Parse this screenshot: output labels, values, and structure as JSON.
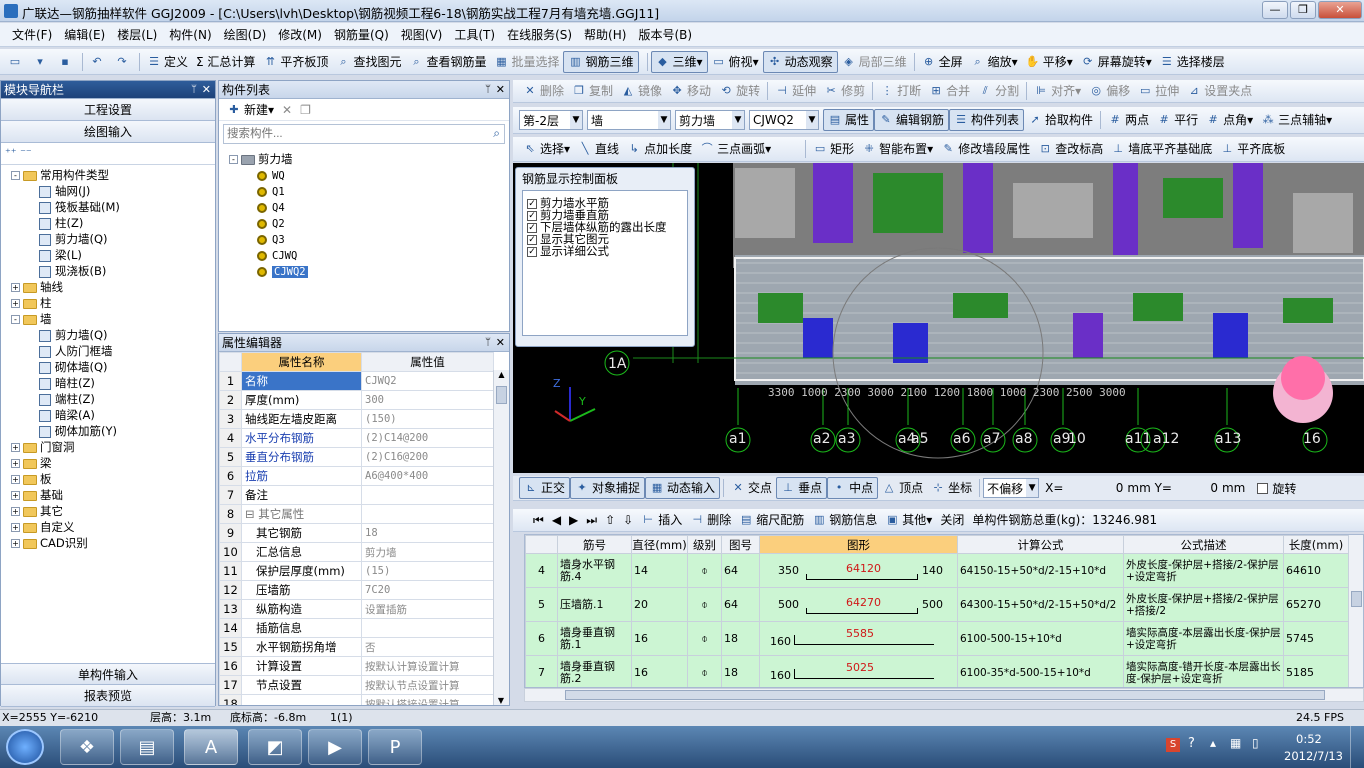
{
  "window": {
    "title": "广联达—钢筋抽样软件 GGJ2009 - [C:\\Users\\lvh\\Desktop\\钢筋视频工程6-18\\钢筋实战工程7月有墙充墙.GGJ11]",
    "minimize": "—",
    "restore": "❐",
    "close": "✕"
  },
  "menu": [
    "文件(F)",
    "编辑(E)",
    "楼层(L)",
    "构件(N)",
    "绘图(D)",
    "修改(M)",
    "钢筋量(Q)",
    "视图(V)",
    "工具(T)",
    "在线服务(S)",
    "帮助(H)",
    "版本号(B)"
  ],
  "toolbar1": {
    "left": [
      "定义",
      "Σ 汇总计算",
      "平齐板顶",
      "查找图元",
      "查看钢筋量",
      "批量选择",
      "钢筋三维"
    ],
    "right": [
      "三维",
      "俯视",
      "动态观察",
      "局部三维",
      "全屏",
      "缩放",
      "平移",
      "屏幕旋转",
      "选择楼层"
    ]
  },
  "toolbar2": [
    "删除",
    "复制",
    "镜像",
    "移动",
    "旋转",
    "延伸",
    "修剪",
    "打断",
    "合并",
    "分割",
    "对齐",
    "偏移",
    "拉伸",
    "设置夹点"
  ],
  "toolbar3": {
    "floor": "第-2层",
    "category": "墙",
    "type": "剪力墙",
    "component": "CJWQ2",
    "buttons": [
      "属性",
      "编辑钢筋",
      "构件列表",
      "拾取构件",
      "两点",
      "平行",
      "点角",
      "三点辅轴"
    ]
  },
  "toolbar4": [
    "选择",
    "直线",
    "点加长度",
    "三点画弧",
    "矩形",
    "智能布置",
    "修改墙段属性",
    "查改标高",
    "墙底平齐基础底",
    "平齐底板"
  ],
  "nav": {
    "title": "模块导航栏",
    "btn_project": "工程设置",
    "btn_draw": "绘图输入",
    "tree": [
      {
        "label": "常用构件类型",
        "level": 0,
        "exp": "-",
        "icon": "folder"
      },
      {
        "label": "轴网(J)",
        "level": 2,
        "icon": "c"
      },
      {
        "label": "筏板基础(M)",
        "level": 2,
        "icon": "c"
      },
      {
        "label": "柱(Z)",
        "level": 2,
        "icon": "c"
      },
      {
        "label": "剪力墙(Q)",
        "level": 2,
        "icon": "c"
      },
      {
        "label": "梁(L)",
        "level": 2,
        "icon": "c"
      },
      {
        "label": "现浇板(B)",
        "level": 2,
        "icon": "c"
      },
      {
        "label": "轴线",
        "level": 0,
        "exp": "+",
        "icon": "folder"
      },
      {
        "label": "柱",
        "level": 0,
        "exp": "+",
        "icon": "folder"
      },
      {
        "label": "墙",
        "level": 0,
        "exp": "-",
        "icon": "folder"
      },
      {
        "label": "剪力墙(Q)",
        "level": 2,
        "icon": "c"
      },
      {
        "label": "人防门框墙",
        "level": 2,
        "icon": "c"
      },
      {
        "label": "砌体墙(Q)",
        "level": 2,
        "icon": "c"
      },
      {
        "label": "暗柱(Z)",
        "level": 2,
        "icon": "c"
      },
      {
        "label": "端柱(Z)",
        "level": 2,
        "icon": "c"
      },
      {
        "label": "暗梁(A)",
        "level": 2,
        "icon": "c"
      },
      {
        "label": "砌体加筋(Y)",
        "level": 2,
        "icon": "c"
      },
      {
        "label": "门窗洞",
        "level": 0,
        "exp": "+",
        "icon": "folder"
      },
      {
        "label": "梁",
        "level": 0,
        "exp": "+",
        "icon": "folder"
      },
      {
        "label": "板",
        "level": 0,
        "exp": "+",
        "icon": "folder"
      },
      {
        "label": "基础",
        "level": 0,
        "exp": "+",
        "icon": "folder"
      },
      {
        "label": "其它",
        "level": 0,
        "exp": "+",
        "icon": "folder"
      },
      {
        "label": "自定义",
        "level": 0,
        "exp": "+",
        "icon": "folder"
      },
      {
        "label": "CAD识别",
        "level": 0,
        "exp": "+",
        "icon": "folder"
      }
    ],
    "btn_single": "单构件输入",
    "btn_report": "报表预览"
  },
  "complist": {
    "title": "构件列表",
    "new": "新建",
    "search_placeholder": "搜索构件...",
    "root": "剪力墙",
    "items": [
      "WQ",
      "Q1",
      "Q4",
      "Q2",
      "Q3",
      "CJWQ",
      "CJWQ2"
    ]
  },
  "props": {
    "title": "属性编辑器",
    "col_name": "属性名称",
    "col_value": "属性值",
    "rows": [
      {
        "n": "1",
        "name": "名称",
        "value": "CJWQ2",
        "style": "sel"
      },
      {
        "n": "2",
        "name": "厚度(mm)",
        "value": "300",
        "style": ""
      },
      {
        "n": "3",
        "name": "轴线距左墙皮距离",
        "value": "(150)",
        "style": ""
      },
      {
        "n": "4",
        "name": "水平分布钢筋",
        "value": "(2)C14@200",
        "style": "blue"
      },
      {
        "n": "5",
        "name": "垂直分布钢筋",
        "value": "(2)C16@200",
        "style": "blue"
      },
      {
        "n": "6",
        "name": "拉筋",
        "value": "A6@400*400",
        "style": "blue"
      },
      {
        "n": "7",
        "name": "备注",
        "value": "",
        "style": ""
      },
      {
        "n": "8",
        "name": "⊟ 其它属性",
        "value": "",
        "style": "group"
      },
      {
        "n": "9",
        "name": "其它钢筋",
        "value": "18",
        "style": "sub"
      },
      {
        "n": "10",
        "name": "汇总信息",
        "value": "剪力墙",
        "style": "sub"
      },
      {
        "n": "11",
        "name": "保护层厚度(mm)",
        "value": "(15)",
        "style": "sub"
      },
      {
        "n": "12",
        "name": "压墙筋",
        "value": "7C20",
        "style": "sub"
      },
      {
        "n": "13",
        "name": "纵筋构造",
        "value": "设置插筋",
        "style": "sub"
      },
      {
        "n": "14",
        "name": "插筋信息",
        "value": "",
        "style": "sub"
      },
      {
        "n": "15",
        "name": "水平钢筋拐角增",
        "value": "否",
        "style": "sub"
      },
      {
        "n": "16",
        "name": "计算设置",
        "value": "按默认计算设置计算",
        "style": "sub"
      },
      {
        "n": "17",
        "name": "节点设置",
        "value": "按默认节点设置计算",
        "style": "sub"
      },
      {
        "n": "18",
        "name": "",
        "value": "按默认搭接设置计算",
        "style": "sub"
      }
    ]
  },
  "ctrlpanel": {
    "title": "钢筋显示控制面板",
    "items": [
      "剪力墙水平筋",
      "剪力墙垂直筋",
      "下层墙体纵筋的露出长度",
      "显示其它图元",
      "显示详细公式"
    ]
  },
  "axis_labels": [
    "1A",
    "a1",
    "a2",
    "a3",
    "a4",
    "a5",
    "a6",
    "a7",
    "a8",
    "a9",
    "10",
    "a11",
    "a12",
    "a13",
    "16"
  ],
  "snapbar": {
    "buttons": [
      "正交",
      "对象捕捉",
      "动态输入",
      "交点",
      "垂点",
      "中点",
      "顶点",
      "坐标"
    ],
    "offset": "不偏移",
    "x_label": "X=",
    "x_val": "0",
    "y_label": "mm Y=",
    "y_val": "0",
    "unit": "mm",
    "rotate": "旋转"
  },
  "rebarbar": {
    "buttons": [
      "插入",
      "删除",
      "缩尺配筋",
      "钢筋信息",
      "其他",
      "关闭"
    ],
    "total": "单构件钢筋总重(kg)：13246.981"
  },
  "rebar": {
    "headers": [
      "筋号",
      "直径(mm)",
      "级别",
      "图号",
      "图形",
      "计算公式",
      "公式描述",
      "长度(mm)"
    ],
    "rows": [
      {
        "n": "4",
        "name": "墙身水平钢筋.4",
        "dia": "14",
        "grade": "⌽",
        "fig": "64",
        "l": "350",
        "mid": "64120",
        "r": "140",
        "formula": "64150-15+50*d/2-15+10*d",
        "desc": "外皮长度-保护层+搭接/2-保护层+设定弯折",
        "len": "64610",
        "kind": "u"
      },
      {
        "n": "5",
        "name": "压墙筋.1",
        "dia": "20",
        "grade": "⌽",
        "fig": "64",
        "l": "500",
        "mid": "64270",
        "r": "500",
        "formula": "64300-15+50*d/2-15+50*d/2",
        "desc": "外皮长度-保护层+搭接/2-保护层+搭接/2",
        "len": "65270",
        "kind": "u"
      },
      {
        "n": "6",
        "name": "墙身垂直钢筋.1",
        "dia": "16",
        "grade": "⌽",
        "fig": "18",
        "l": "160",
        "mid": "5585",
        "r": "",
        "formula": "6100-500-15+10*d",
        "desc": "墙实际高度-本层露出长度-保护层+设定弯折",
        "len": "5745",
        "kind": "l"
      },
      {
        "n": "7",
        "name": "墙身垂直钢筋.2",
        "dia": "16",
        "grade": "⌽",
        "fig": "18",
        "l": "160",
        "mid": "5025",
        "r": "",
        "formula": "6100-35*d-500-15+10*d",
        "desc": "墙实际高度-错开长度-本层露出长度-保护层+设定弯折",
        "len": "5185",
        "kind": "l"
      }
    ]
  },
  "status": {
    "coords": "X=2555 Y=-6210",
    "floor_h": "层高：3.1m",
    "base_h": "底标高：-6.8m",
    "count": "1(1)",
    "fps": "24.5 FPS"
  },
  "taskbar": {
    "time": "0:52",
    "date": "2012/7/13"
  }
}
